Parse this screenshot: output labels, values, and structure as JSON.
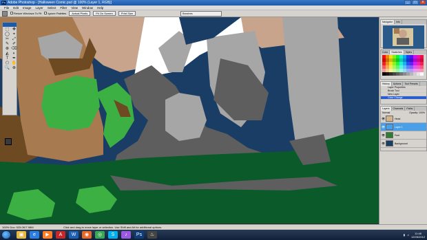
{
  "window": {
    "title": "Adobe Photoshop - [Halloween Comic.psd @ 100% (Layer 1, RGB)]",
    "app_icon_text": "Ps",
    "controls": {
      "minimize": "_",
      "maximize": "□",
      "close": "x"
    }
  },
  "menu": [
    "File",
    "Edit",
    "Image",
    "Layer",
    "Select",
    "Filter",
    "View",
    "Window",
    "Help"
  ],
  "options": {
    "resize_windows_label": "Resize Windows To Fit",
    "ignore_palettes_label": "Ignore Palettes",
    "actual_pixels_label": "Actual Pixels",
    "fit_on_screen_label": "Fit On Screen",
    "print_size_label": "Print Size",
    "brushes_label": "Brushes"
  },
  "toolbox": {
    "tools": [
      "⬚",
      "✥",
      "◯",
      "⌖",
      "✂",
      "⤢",
      "✎",
      "✐",
      "⊗",
      "⌫",
      "◭",
      "◐",
      "T",
      "✒",
      "⬠",
      "✋",
      "🔍",
      "⊕"
    ]
  },
  "panels": {
    "navigator_tabs": [
      "Navigator",
      "Info"
    ],
    "swatches_tabs": [
      "Color",
      "Swatches",
      "Styles"
    ],
    "history_tabs": [
      "History",
      "Actions",
      "Tool Presets"
    ],
    "history_items": [
      "Layer Properties",
      "Brush Tool",
      "New Layer",
      "Color Change"
    ],
    "layers_tabs": [
      "Layers",
      "Channels",
      "Paths"
    ],
    "layers_mode": "Normal",
    "layers_opacity": "Opacity: 100%",
    "layers": [
      {
        "name": "Head",
        "color": "#d4b48c",
        "selected": false
      },
      {
        "name": "Layer 1",
        "color": "#4aa0e8",
        "selected": true
      },
      {
        "name": "Feet",
        "color": "#2e7d32",
        "selected": false
      },
      {
        "name": "Background",
        "color": "#1a3d66",
        "selected": false
      }
    ]
  },
  "status": {
    "zoom_doc": "100%  Doc: 525.0K/7.98M",
    "message": "Click and drag to move layer or selection. Use Shift and Alt for additional options."
  },
  "taskbar": {
    "apps": [
      {
        "name": "explorer-app",
        "glyph": "▣",
        "color": "#e8b845"
      },
      {
        "name": "ie-app",
        "glyph": "e",
        "color": "#2a7de1"
      },
      {
        "name": "media-app",
        "glyph": "▶",
        "color": "#ff7f27"
      },
      {
        "name": "acrobat-app",
        "glyph": "A",
        "color": "#c62828"
      },
      {
        "name": "word-app",
        "glyph": "W",
        "color": "#1e5fb4"
      },
      {
        "name": "firefox-app",
        "glyph": "◉",
        "color": "#e8682a"
      },
      {
        "name": "chrome-app",
        "glyph": "◎",
        "color": "#3aa757"
      },
      {
        "name": "skype-app",
        "glyph": "S",
        "color": "#00aff0"
      },
      {
        "name": "itunes-app",
        "glyph": "♪",
        "color": "#9a5ae0"
      },
      {
        "name": "photoshop-app",
        "glyph": "Ps",
        "color": "#0f3d7a"
      },
      {
        "name": "steam-app",
        "glyph": "♨",
        "color": "#444444"
      }
    ],
    "time": "11:48",
    "date": "12/26/2012"
  },
  "colors": {
    "sky": "#1a3d66",
    "grass": "#0a5a2a",
    "dark_gray": "#5e5e5e",
    "light_gray": "#a6a6a6",
    "skin": "#c8a48c",
    "brown": "#a87a50",
    "green": "#3cb043",
    "white": "#ffffff"
  }
}
